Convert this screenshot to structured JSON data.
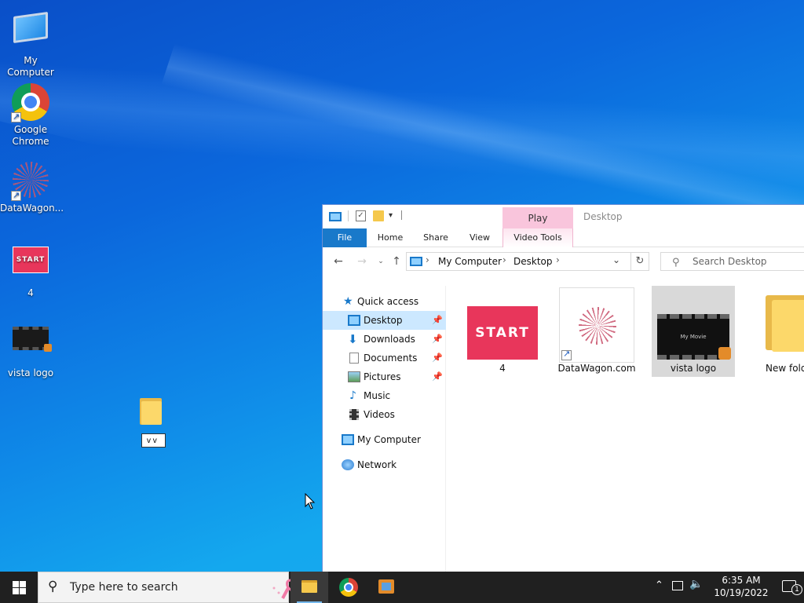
{
  "desktop": {
    "icons": [
      {
        "label": "My Computer",
        "icon": "computer-icon"
      },
      {
        "label": "Google\nChrome",
        "icon": "chrome-icon"
      },
      {
        "label": "DataWagon...",
        "icon": "datawagon-icon"
      },
      {
        "label": "4",
        "icon": "start-image-thumbnail"
      },
      {
        "label": "vista logo",
        "icon": "video-file-icon"
      }
    ],
    "new_folder": {
      "rename_value": "v v",
      "icon": "folder-icon"
    },
    "start_thumb_text": "START"
  },
  "explorer": {
    "window_title": "Desktop",
    "contextual_tab": "Play",
    "ribbon_tabs": [
      "File",
      "Home",
      "Share",
      "View",
      "Video Tools"
    ],
    "breadcrumb": [
      "My Computer",
      "Desktop"
    ],
    "search_placeholder": "Search Desktop",
    "nav": {
      "quick_access": "Quick access",
      "items": [
        {
          "label": "Desktop",
          "pinned": true,
          "selected": true
        },
        {
          "label": "Downloads",
          "pinned": true
        },
        {
          "label": "Documents",
          "pinned": true
        },
        {
          "label": "Pictures",
          "pinned": true
        },
        {
          "label": "Music",
          "pinned": false
        },
        {
          "label": "Videos",
          "pinned": false
        }
      ],
      "my_computer": "My Computer",
      "network": "Network"
    },
    "files": [
      {
        "name": "4",
        "type": "image",
        "thumb_text": "START"
      },
      {
        "name": "DataWagon.com",
        "type": "shortcut"
      },
      {
        "name": "vista logo",
        "type": "video",
        "thumb_text": "My Movie",
        "selected": true
      },
      {
        "name": "New fold",
        "type": "folder"
      }
    ]
  },
  "taskbar": {
    "search_placeholder": "Type here to search",
    "apps": [
      "file-explorer-icon",
      "chrome-icon",
      "movie-maker-icon"
    ],
    "time": "6:35 AM",
    "date": "10/19/2022",
    "notifications": "1"
  },
  "colors": {
    "accent": "#1979ca",
    "taskbar": "#202020",
    "selection": "#cce8ff",
    "play_tab": "#f9c5dc"
  }
}
